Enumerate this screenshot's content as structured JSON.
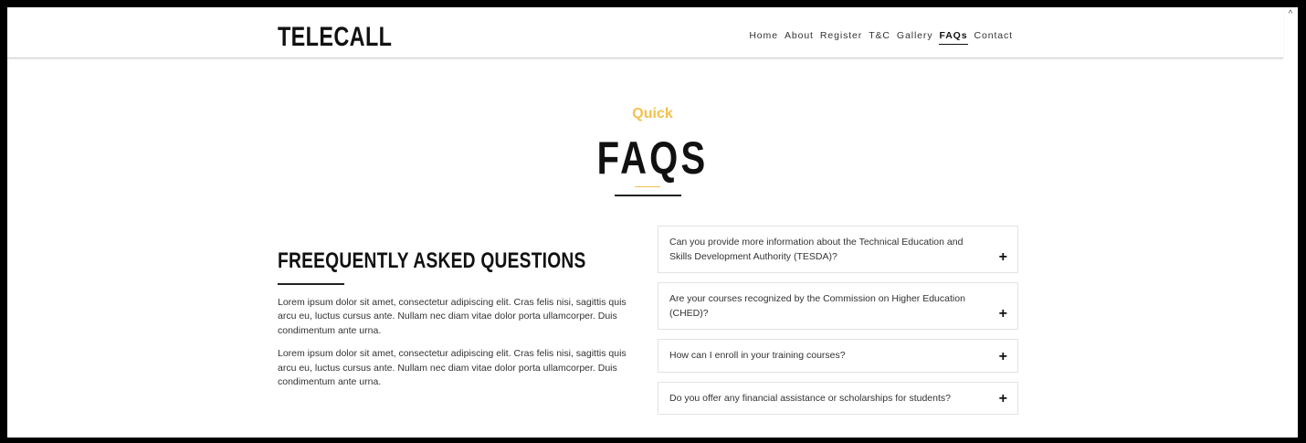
{
  "header": {
    "brand": "TELECALL",
    "nav": [
      {
        "label": "Home"
      },
      {
        "label": "About"
      },
      {
        "label": "Register"
      },
      {
        "label": "T&C"
      },
      {
        "label": "Gallery"
      },
      {
        "label": "FAQs",
        "active": true
      },
      {
        "label": "Contact"
      }
    ]
  },
  "section": {
    "kicker": "Quick",
    "title": "FAQS"
  },
  "intro": {
    "heading": "FREEQUENTLY ASKED QUESTIONS",
    "paragraphs": [
      "Lorem ipsum dolor sit amet, consectetur adipiscing elit. Cras felis nisi, sagittis quis arcu eu, luctus cursus ante. Nullam nec diam vitae dolor porta ullamcorper. Duis condimentum ante urna.",
      "Lorem ipsum dolor sit amet, consectetur adipiscing elit. Cras felis nisi, sagittis quis arcu eu, luctus cursus ante. Nullam nec diam vitae dolor porta ullamcorper. Duis condimentum ante urna."
    ]
  },
  "faqs": [
    {
      "question": "Can you provide more information about the Technical Education and Skills Development Authority (TESDA)?",
      "toggle": "+"
    },
    {
      "question": "Are your courses recognized by the Commission on Higher Education (CHED)?",
      "toggle": "+"
    },
    {
      "question": "How can I enroll in your training courses?",
      "toggle": "+"
    },
    {
      "question": "Do you offer any financial assistance or scholarships for students?",
      "toggle": "+"
    }
  ],
  "scrollbar": {
    "up_glyph": "^"
  },
  "colors": {
    "accent": "#f2c14e",
    "text": "#111111",
    "border": "#e3e3e3"
  }
}
